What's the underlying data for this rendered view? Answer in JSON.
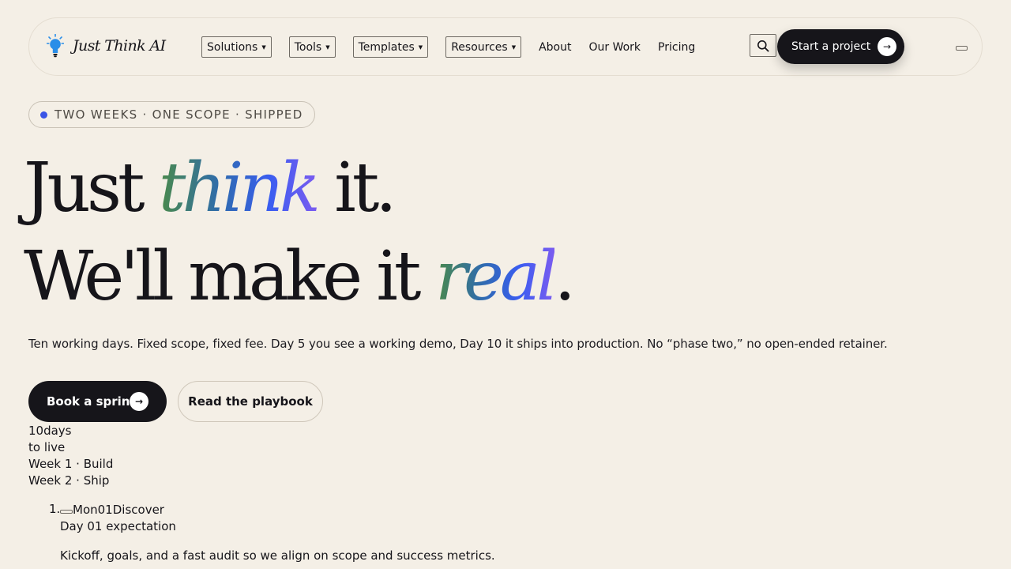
{
  "brand": {
    "name": "Just Think AI",
    "accent": "#16151a",
    "bulb_color": "#2a8ee8"
  },
  "nav": {
    "dropdowns": [
      {
        "label": "Solutions"
      },
      {
        "label": "Tools"
      },
      {
        "label": "Templates"
      },
      {
        "label": "Resources"
      }
    ],
    "links": [
      {
        "label": "About"
      },
      {
        "label": "Our Work"
      },
      {
        "label": "Pricing"
      }
    ],
    "search_icon": "search-icon",
    "cta_label": "Start a project",
    "cta_arrow": "→"
  },
  "hero": {
    "badge": "TWO WEEKS · ONE SCOPE · SHIPPED",
    "badge_dot_color": "#3b55e6",
    "line1": {
      "before": "Just ",
      "accent": "think",
      "after": " it."
    },
    "line2": {
      "before": "We'll make it ",
      "accent": "real",
      "after": "."
    },
    "subhead": "Ten working days. Fixed scope, fixed fee. Day 5 you see a working demo, Day 10 it ships into production. No “phase two,” no open-ended retainer.",
    "primary_cta": "Book a sprint",
    "primary_arrow": "→",
    "secondary_cta": "Read the playbook"
  },
  "stats": {
    "number": "10",
    "unit": "days",
    "caption": "to live",
    "week1": "Week 1 · Build",
    "week2": "Week 2 · Ship"
  },
  "timeline": [
    {
      "index": "1.",
      "day": "Mon",
      "num": "01",
      "title": "Discover",
      "expectation": "Day 01 expectation",
      "description": "Kickoff, goals, and a fast audit so we align on scope and success metrics."
    }
  ]
}
